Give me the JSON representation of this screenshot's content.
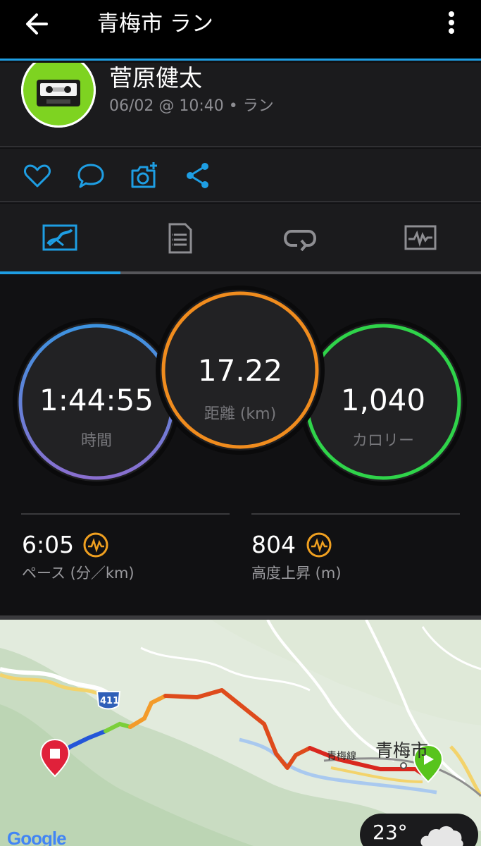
{
  "app": {
    "title": "青梅市 ラン"
  },
  "activity": {
    "user_name": "菅原健太",
    "meta": "06/02 @ 10:40 • ラン"
  },
  "actions": {
    "icons": [
      "heart-icon",
      "comment-icon",
      "add-photo-icon",
      "share-icon"
    ]
  },
  "tabs": [
    {
      "icon": "overview-map-icon",
      "active": true
    },
    {
      "icon": "details-list-icon",
      "active": false
    },
    {
      "icon": "laps-icon",
      "active": false
    },
    {
      "icon": "chart-icon",
      "active": false
    }
  ],
  "stats": {
    "time": {
      "value": "1:44:55",
      "label": "時間"
    },
    "distance": {
      "value": "17.22",
      "label": "距離 (km)"
    },
    "calories": {
      "value": "1,040",
      "label": "カロリー"
    },
    "pace": {
      "value": "6:05",
      "label": "ペース (分／km)"
    },
    "elevation": {
      "value": "804",
      "label": "高度上昇 (m)"
    }
  },
  "map": {
    "route_number": "411",
    "line_label": "青梅線",
    "city_label": "青梅市",
    "provider": "Google",
    "weather_temp": "23°"
  },
  "colors": {
    "accent": "#1e9ee3",
    "time_ring": "#4a8fe0",
    "distance_ring": "#f08c1e",
    "calories_ring": "#2fd44a",
    "metric_icon": "#f0a020"
  }
}
